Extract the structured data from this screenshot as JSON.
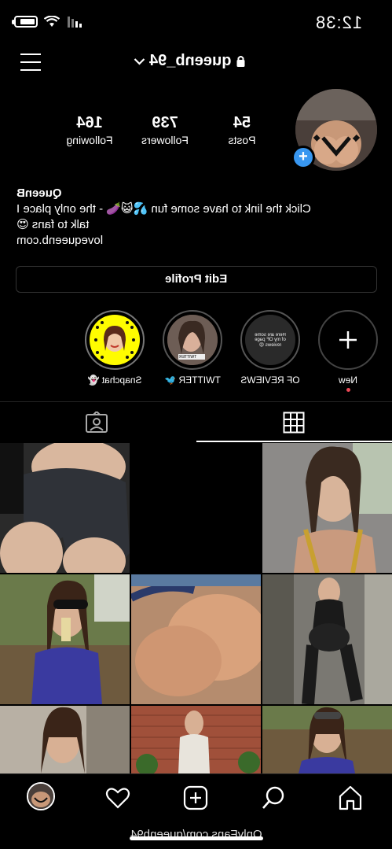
{
  "status_bar": {
    "time": "12:38"
  },
  "header": {
    "username": "queenb_94"
  },
  "stats": {
    "posts": {
      "count": "54",
      "label": "Posts"
    },
    "followers": {
      "count": "739",
      "label": "Followers"
    },
    "following": {
      "count": "164",
      "label": "Following"
    }
  },
  "bio": {
    "name": "QueenB",
    "line1": "Click the link to have some fun 💦😺🍆 - the only place I",
    "line2": "talk to fans 😍",
    "link": "lovequeenb.com"
  },
  "edit_profile_label": "Edit Profile",
  "highlights": [
    {
      "label": "New"
    },
    {
      "label": "OF REVIEWS",
      "thumb_text": "Here are some of my OF page reviews 😍"
    },
    {
      "label": "TWITTER 🐦",
      "thumb_text": "TWITTER"
    },
    {
      "label": "Snapchat 👻"
    }
  ],
  "footer": {
    "url": "OnlyFans.com/queenb94"
  },
  "colors": {
    "accent": "#3897f0",
    "background": "#000000",
    "notification_dot": "#ed4956"
  }
}
